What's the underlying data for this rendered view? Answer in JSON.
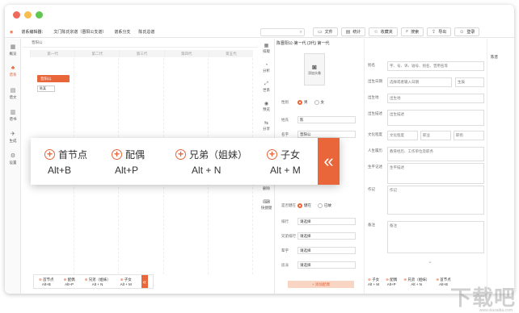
{
  "colors": {
    "accent": "#e8663a",
    "dot_red": "#ee6a5b",
    "dot_yellow": "#f5be4f",
    "dot_green": "#62c554"
  },
  "breadcrumb": [
    "谱系编辑器：",
    "文门陈氏宗谱（晋阳公支谱）",
    "谱系分支",
    "陈氏总谱"
  ],
  "search": {
    "placeholder": ""
  },
  "toolbar": [
    {
      "icon": "file-icon",
      "label": "文件"
    },
    {
      "icon": "stats-icon",
      "label": "统计"
    },
    {
      "icon": "star-icon",
      "label": "收藏夹"
    },
    {
      "icon": "search-icon",
      "label": "搜索"
    },
    {
      "icon": "export-icon",
      "label": "导出"
    },
    {
      "icon": "user-icon",
      "label": "登录"
    }
  ],
  "leftnav": [
    {
      "icon": "overview-icon",
      "label": "概览",
      "active": false
    },
    {
      "icon": "tree-icon",
      "label": "谱系",
      "active": true
    },
    {
      "icon": "doc-icon",
      "label": "谱文",
      "active": false
    },
    {
      "icon": "book-icon",
      "label": "谱书",
      "active": false
    },
    {
      "icon": "generate-icon",
      "label": "生成",
      "active": false
    },
    {
      "icon": "settings-icon",
      "label": "设置",
      "active": false
    }
  ],
  "tree": {
    "header": "晋阳公",
    "generations": [
      "第一代",
      "第二代",
      "第三代",
      "第四代",
      "第五代"
    ],
    "root_node": "晋阳公",
    "child_node": "陈某"
  },
  "shortcuts": [
    {
      "label": "首节点",
      "key": "Alt+B"
    },
    {
      "label": "配偶",
      "key": "Alt+P"
    },
    {
      "label": "兄弟（姐妹）",
      "key": "Alt + N"
    },
    {
      "label": "子女",
      "key": "Alt + M"
    }
  ],
  "bottom_shortcuts": [
    {
      "label": "首节点",
      "key": "Alt+B"
    },
    {
      "label": "配偶",
      "key": "Alt+P"
    },
    {
      "label": "兄弟（姐妹）",
      "key": "Alt + N"
    },
    {
      "label": "子女",
      "key": "Alt + M"
    }
  ],
  "vtools": [
    {
      "icon": "arrange-icon",
      "label": "排版"
    },
    {
      "icon": "chart-icon",
      "label": "分析"
    },
    {
      "icon": "tree-line-icon",
      "label": "世系"
    },
    {
      "icon": "eye-icon",
      "label": "预览"
    },
    {
      "icon": "share-icon",
      "label": "分享"
    },
    {
      "icon": "collect-icon",
      "label": "收藏"
    },
    {
      "icon": "delete-icon",
      "label": "删除"
    },
    {
      "icon": "shortcut-icon",
      "label": "快捷键"
    }
  ],
  "person": {
    "title": "陈晋阳公-第一代 (3代) 第一代",
    "photo_label": "添加头像",
    "gender_label": "性别",
    "gender_male": "男",
    "gender_female": "女",
    "surname_label": "姓氏",
    "surname": "陈",
    "name_label": "名字",
    "name": "晋阳公",
    "alive_label": "是否健在",
    "alive_yes": "健在",
    "alive_no": "已故",
    "rank_label": "排行",
    "rank": "请选择",
    "brother_label": "兄弟排行",
    "brother_rank": "请选择",
    "seq_label": "辈字",
    "seq": "请选择",
    "branch_label": "房派",
    "branch": "请选择",
    "add_button": "+ 添加配偶"
  },
  "details": {
    "alias_label": "别名",
    "alias_placeholder": "字、号、讳、谥号、别名、曾用名等",
    "birth_label": "出生日期",
    "birth_placeholder": "选择或者输入日期",
    "birth_select": "生辰",
    "birthplace_label": "出生地",
    "birthplace_placeholder": "出生地",
    "desc_label": "出生描述",
    "desc_placeholder": "出生描述",
    "edu_label": "文化程度",
    "edu_select": "文化程度",
    "job_placeholder": "职业",
    "post_placeholder": "职衔",
    "resume_label": "人生履历",
    "resume_placeholder": "教育经历、工作单位及职务",
    "bio_label": "生平记述",
    "bio_placeholder": "生平描述",
    "work_label": "作记",
    "work_placeholder": "作记",
    "note_label": "备注",
    "note_placeholder": "备注"
  },
  "farright": {
    "label": "陈晋"
  },
  "watermark": {
    "text": "下载吧",
    "sub": "www.xiazaiba.com"
  }
}
